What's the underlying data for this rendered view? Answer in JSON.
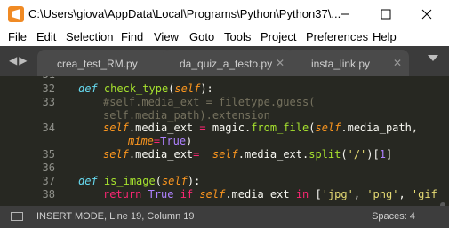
{
  "window": {
    "title": "C:\\Users\\giova\\AppData\\Local\\Programs\\Python\\Python37\\...",
    "icon": "sublime-text-icon",
    "controls": [
      "minimize-icon",
      "maximize-icon",
      "close-icon"
    ]
  },
  "menu": {
    "file": "File",
    "edit": "Edit",
    "selection": "Selection",
    "find": "Find",
    "view": "View",
    "goto": "Goto",
    "tools": "Tools",
    "project": "Project",
    "preferences": "Preferences",
    "help": "Help"
  },
  "tabs": [
    {
      "label": "crea_test_RM.py",
      "close": "✕"
    },
    {
      "label": "da_quiz_a_testo.py",
      "close": "✕"
    },
    {
      "label": "insta_link.py",
      "close": "✕"
    }
  ],
  "nav": {
    "arrows": "◀▶"
  },
  "gutter": {
    "l31": "31",
    "l32": "32",
    "l33": "33",
    "l34": "34",
    "l35": "35",
    "l36": "36",
    "l37": "37",
    "l38": "38"
  },
  "code": {
    "def1": "def",
    "fn1": "check_type",
    "paren_open": "(",
    "self": "self",
    "paren_close_colon": "):",
    "comment1": "#self.media_ext = filetype.guess(",
    "comment2": "self.media_path).extension",
    "l34_self": "self",
    "l34_attr": ".media_ext ",
    "eq": "=",
    "l34_mid": " magic.",
    "l34_fn": "from_file",
    "l34_self2": "self",
    "l34_tail": ".media_path,",
    "mime_kw": "mime",
    "mime_eq": "=",
    "true_val": "True",
    "close_paren": ")",
    "l35_self": "self",
    "l35_attr": ".media_ext",
    "l35_eq": "=",
    "l35_self2": "self",
    "l35_mid": ".media_ext.",
    "l35_fn": "split",
    "l35_str": "'/'",
    "l35_tail": ")[",
    "l35_num": "1",
    "l35_end": "]",
    "def2": "def",
    "fn2": "is_image",
    "return_kw": "return",
    "true2": "True",
    "if_kw": "if",
    "l38_self": "self",
    "l38_attr": ".media_ext",
    "in_kw": "in",
    "bracket": "[",
    "str_jpg": "'jpg'",
    "comma": ", ",
    "str_png": "'png'",
    "str_gif": "'gif"
  },
  "status": {
    "mode": "INSERT MODE, Line 19, Column 19",
    "spaces": "Spaces: 4"
  },
  "colors": {
    "editor_bg": "#272822",
    "keyword": "#66d9ef",
    "function": "#a6e22e",
    "self": "#fd971f",
    "operator": "#f92672",
    "comment": "#75715e",
    "string": "#e6db74",
    "number": "#ae81ff",
    "accent": "#f08a24"
  }
}
